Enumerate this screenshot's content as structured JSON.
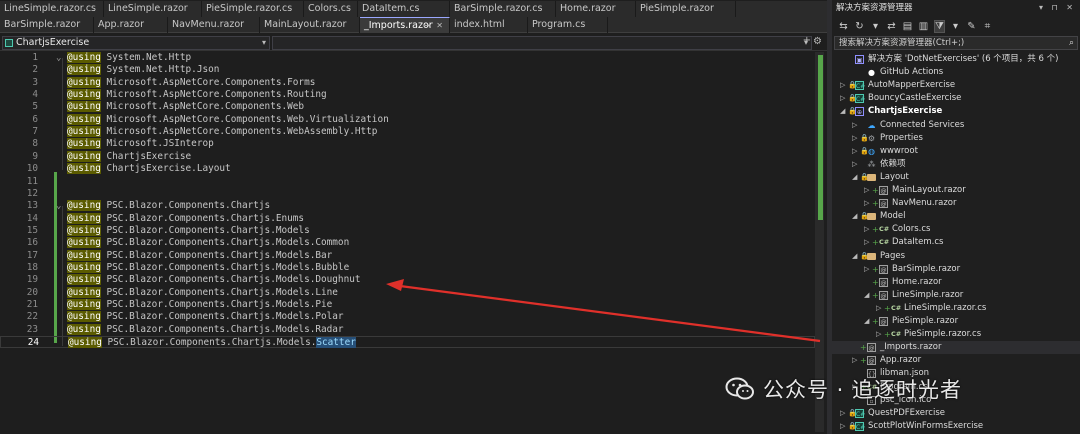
{
  "tabs_row1": [
    {
      "label": "LineSimple.razor.cs",
      "width": 104
    },
    {
      "label": "LineSimple.razor",
      "width": 98
    },
    {
      "label": "PieSimple.razor.cs",
      "width": 102
    },
    {
      "label": "Colors.cs",
      "width": 54
    },
    {
      "label": "DataItem.cs",
      "width": 92
    },
    {
      "label": "BarSimple.razor.cs",
      "width": 106
    },
    {
      "label": "Home.razor",
      "width": 80
    },
    {
      "label": "PieSimple.razor",
      "width": 100
    }
  ],
  "tabs_row2": [
    {
      "label": "BarSimple.razor",
      "width": 94
    },
    {
      "label": "App.razor",
      "width": 74
    },
    {
      "label": "NavMenu.razor",
      "width": 92
    },
    {
      "label": "MainLayout.razor",
      "width": 100
    },
    {
      "label": "_Imports.razor",
      "width": 90,
      "active": true
    },
    {
      "label": "index.html",
      "width": 78
    },
    {
      "label": "Program.cs",
      "width": 80
    }
  ],
  "navbar": {
    "project": "ChartjsExercise",
    "second": ""
  },
  "code_lines": [
    {
      "n": "1",
      "kw": "@using",
      "text": " System.Net.Http",
      "fold": true
    },
    {
      "n": "2",
      "kw": "@using",
      "text": " System.Net.Http.Json"
    },
    {
      "n": "3",
      "kw": "@using",
      "text": " Microsoft.AspNetCore.Components.Forms"
    },
    {
      "n": "4",
      "kw": "@using",
      "text": " Microsoft.AspNetCore.Components.Routing"
    },
    {
      "n": "5",
      "kw": "@using",
      "text": " Microsoft.AspNetCore.Components.Web"
    },
    {
      "n": "6",
      "kw": "@using",
      "text": " Microsoft.AspNetCore.Components.Web.Virtualization"
    },
    {
      "n": "7",
      "kw": "@using",
      "text": " Microsoft.AspNetCore.Components.WebAssembly.Http"
    },
    {
      "n": "8",
      "kw": "@using",
      "text": " Microsoft.JSInterop"
    },
    {
      "n": "9",
      "kw": "@using",
      "text": " ChartjsExercise"
    },
    {
      "n": "10",
      "kw": "@using",
      "text": " ChartjsExercise.Layout"
    },
    {
      "n": "11",
      "kw": "",
      "text": ""
    },
    {
      "n": "12",
      "kw": "",
      "text": ""
    },
    {
      "n": "13",
      "kw": "@using",
      "text": " PSC.Blazor.Components.Chartjs",
      "fold": true
    },
    {
      "n": "14",
      "kw": "@using",
      "text": " PSC.Blazor.Components.Chartjs.Enums"
    },
    {
      "n": "15",
      "kw": "@using",
      "text": " PSC.Blazor.Components.Chartjs.Models"
    },
    {
      "n": "16",
      "kw": "@using",
      "text": " PSC.Blazor.Components.Chartjs.Models.Common"
    },
    {
      "n": "17",
      "kw": "@using",
      "text": " PSC.Blazor.Components.Chartjs.Models.Bar"
    },
    {
      "n": "18",
      "kw": "@using",
      "text": " PSC.Blazor.Components.Chartjs.Models.Bubble"
    },
    {
      "n": "19",
      "kw": "@using",
      "text": " PSC.Blazor.Components.Chartjs.Models.Doughnut"
    },
    {
      "n": "20",
      "kw": "@using",
      "text": " PSC.Blazor.Components.Chartjs.Models.Line"
    },
    {
      "n": "21",
      "kw": "@using",
      "text": " PSC.Blazor.Components.Chartjs.Models.Pie"
    },
    {
      "n": "22",
      "kw": "@using",
      "text": " PSC.Blazor.Components.Chartjs.Models.Polar"
    },
    {
      "n": "23",
      "kw": "@using",
      "text": " PSC.Blazor.Components.Chartjs.Models.Radar"
    },
    {
      "n": "24",
      "kw": "@using",
      "text": " PSC.Blazor.Components.Chartjs.Models.",
      "sel": "Scatter",
      "current": true
    }
  ],
  "explorer": {
    "title": "解决方案资源管理器",
    "search_placeholder": "搜索解决方案资源管理器(Ctrl+;)",
    "nodes": [
      {
        "label": "解决方案 'DotNetExercises' (6 个项目，共 6 个)",
        "indent": 0,
        "icon": "solution",
        "icon_glyph": "▣",
        "arrow": "",
        "name": "solution-node"
      },
      {
        "label": "GitHub Actions",
        "indent": 1,
        "icon": "gh",
        "icon_glyph": "●",
        "arrow": "",
        "name": "github-actions-node"
      },
      {
        "label": "AutoMapperExercise",
        "indent": 0,
        "icon": "project",
        "icon_glyph": "C#",
        "arrow": "▷",
        "lock": true,
        "name": "project-automapper"
      },
      {
        "label": "BouncyCastleExercise",
        "indent": 0,
        "icon": "project",
        "icon_glyph": "C#",
        "arrow": "▷",
        "lock": true,
        "name": "project-bouncycastle"
      },
      {
        "label": "ChartjsExercise",
        "indent": 0,
        "icon": "solution",
        "icon_glyph": "⊕",
        "arrow": "◢",
        "lock": true,
        "bold": true,
        "name": "project-chartjs"
      },
      {
        "label": "Connected Services",
        "indent": 1,
        "icon": "link",
        "icon_glyph": "☁",
        "arrow": "▷",
        "name": "connected-services-node"
      },
      {
        "label": "Properties",
        "indent": 1,
        "icon": "gear",
        "icon_glyph": "⚙",
        "arrow": "▷",
        "lock": true,
        "name": "properties-node"
      },
      {
        "label": "wwwroot",
        "indent": 1,
        "icon": "web",
        "icon_glyph": "◍",
        "arrow": "▷",
        "lock": true,
        "name": "wwwroot-node"
      },
      {
        "label": "依赖项",
        "indent": 1,
        "icon": "gear",
        "icon_glyph": "⁂",
        "arrow": "▷",
        "name": "dependencies-node"
      },
      {
        "label": "Layout",
        "indent": 1,
        "icon": "folder",
        "icon_glyph": "",
        "arrow": "◢",
        "lock": true,
        "name": "folder-layout"
      },
      {
        "label": "MainLayout.razor",
        "indent": 2,
        "icon": "razor",
        "icon_glyph": "@",
        "arrow": "▷",
        "plus": true,
        "name": "file-mainlayout"
      },
      {
        "label": "NavMenu.razor",
        "indent": 2,
        "icon": "razor",
        "icon_glyph": "@",
        "arrow": "▷",
        "plus": true,
        "name": "file-navmenu"
      },
      {
        "label": "Model",
        "indent": 1,
        "icon": "folder",
        "icon_glyph": "",
        "arrow": "◢",
        "lock": true,
        "name": "folder-model"
      },
      {
        "label": "Colors.cs",
        "indent": 2,
        "icon": "cs",
        "icon_glyph": "C#",
        "arrow": "▷",
        "plus": true,
        "name": "file-colors"
      },
      {
        "label": "DataItem.cs",
        "indent": 2,
        "icon": "cs",
        "icon_glyph": "C#",
        "arrow": "▷",
        "plus": true,
        "name": "file-dataitem"
      },
      {
        "label": "Pages",
        "indent": 1,
        "icon": "folder",
        "icon_glyph": "",
        "arrow": "◢",
        "lock": true,
        "name": "folder-pages"
      },
      {
        "label": "BarSimple.razor",
        "indent": 2,
        "icon": "razor",
        "icon_glyph": "@",
        "arrow": "▷",
        "plus": true,
        "name": "file-barsimple"
      },
      {
        "label": "Home.razor",
        "indent": 2,
        "icon": "razor",
        "icon_glyph": "@",
        "arrow": "",
        "plus": true,
        "name": "file-home"
      },
      {
        "label": "LineSimple.razor",
        "indent": 2,
        "icon": "razor",
        "icon_glyph": "@",
        "arrow": "◢",
        "plus": true,
        "name": "file-linesimple"
      },
      {
        "label": "LineSimple.razor.cs",
        "indent": 3,
        "icon": "cs",
        "icon_glyph": "C#",
        "arrow": "▷",
        "plus": true,
        "name": "file-linesimple-cs"
      },
      {
        "label": "PieSimple.razor",
        "indent": 2,
        "icon": "razor",
        "icon_glyph": "@",
        "arrow": "◢",
        "plus": true,
        "name": "file-piesimple"
      },
      {
        "label": "PieSimple.razor.cs",
        "indent": 3,
        "icon": "cs",
        "icon_glyph": "C#",
        "arrow": "▷",
        "plus": true,
        "name": "file-piesimple-cs"
      },
      {
        "label": "_Imports.razor",
        "indent": 1,
        "icon": "razor",
        "icon_glyph": "@",
        "arrow": "",
        "plus": true,
        "selected": true,
        "name": "file-imports"
      },
      {
        "label": "App.razor",
        "indent": 1,
        "icon": "razor",
        "icon_glyph": "@",
        "arrow": "▷",
        "plus": true,
        "name": "file-app"
      },
      {
        "label": "libman.json",
        "indent": 1,
        "icon": "json",
        "icon_glyph": "{}",
        "arrow": "",
        "name": "file-libman"
      },
      {
        "label": "Program.cs",
        "indent": 1,
        "icon": "cs",
        "icon_glyph": "C#",
        "arrow": "▷",
        "plus": true,
        "name": "file-program"
      },
      {
        "label": "psc_icon.ico",
        "indent": 1,
        "icon": "json",
        "icon_glyph": "▫",
        "arrow": "",
        "name": "file-icon"
      },
      {
        "label": "QuestPDFExercise",
        "indent": 0,
        "icon": "project",
        "icon_glyph": "C#",
        "arrow": "▷",
        "lock": true,
        "name": "project-questpdf"
      },
      {
        "label": "ScottPlotWinFormsExercise",
        "indent": 0,
        "icon": "project",
        "icon_glyph": "C#",
        "arrow": "▷",
        "lock": true,
        "name": "project-scottplot"
      }
    ]
  },
  "watermark": {
    "text": "公众号 · 追逐时光者"
  },
  "colors": {
    "arrow": "#e0302a",
    "change_bar": "#57a64a",
    "selection": "#264f78"
  }
}
